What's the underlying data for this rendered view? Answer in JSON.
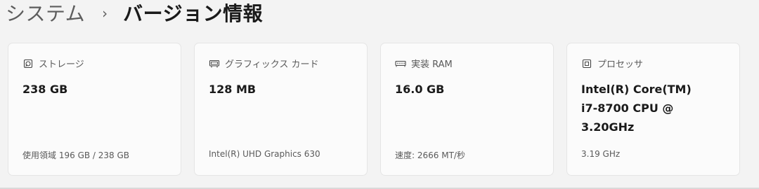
{
  "breadcrumb": {
    "parent": "システム",
    "separator": "›",
    "current": "バージョン情報"
  },
  "cards": [
    {
      "icon": "storage-icon",
      "label": "ストレージ",
      "value": "238 GB",
      "detail_label": "使用領域",
      "detail_value": "196 GB / 238 GB"
    },
    {
      "icon": "graphics-card-icon",
      "label": "グラフィックス カード",
      "value": "128 MB",
      "detail_label": "",
      "detail_value": "Intel(R) UHD Graphics 630"
    },
    {
      "icon": "memory-icon",
      "label": "実装 RAM",
      "value": "16.0 GB",
      "detail_label": "速度:",
      "detail_value": "2666 MT/秒"
    },
    {
      "icon": "processor-icon",
      "label": "プロセッサ",
      "value": "Intel(R) Core(TM)\ni7-8700 CPU @\n3.20GHz",
      "detail_label": "",
      "detail_value": "3.19 GHz"
    }
  ]
}
